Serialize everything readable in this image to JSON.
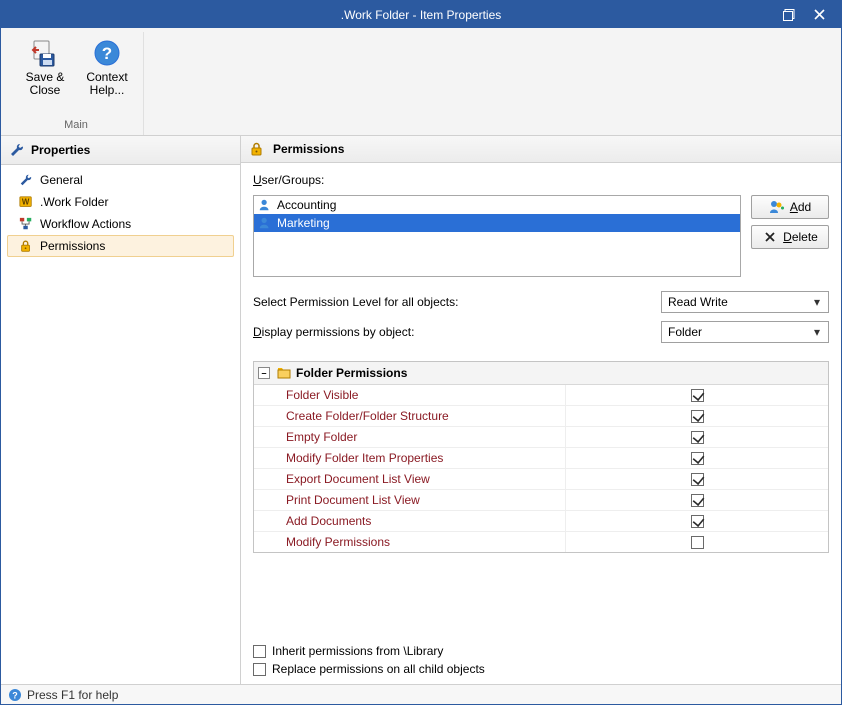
{
  "title": ".Work Folder - Item Properties",
  "ribbon": {
    "group_label": "Main",
    "save_close": "Save & Close",
    "context_help": "Context Help..."
  },
  "sidebar": {
    "header": "Properties",
    "items": [
      {
        "label": "General"
      },
      {
        "label": ".Work Folder"
      },
      {
        "label": "Workflow Actions"
      },
      {
        "label": "Permissions"
      }
    ],
    "selected_index": 3
  },
  "main": {
    "header": "Permissions",
    "user_groups_label": "User/Groups:",
    "user_groups": [
      {
        "name": "Accounting"
      },
      {
        "name": "Marketing"
      }
    ],
    "selected_group_index": 1,
    "add_btn": "Add",
    "delete_btn": "Delete",
    "select_level_label": "Select Permission Level for all objects:",
    "select_level_value": "Read Write",
    "display_by_label": "Display permissions by object:",
    "display_by_value": "Folder",
    "grid_title": "Folder Permissions",
    "permissions": [
      {
        "label": "Folder Visible",
        "checked": true
      },
      {
        "label": "Create Folder/Folder Structure",
        "checked": true
      },
      {
        "label": "Empty Folder",
        "checked": true
      },
      {
        "label": "Modify Folder Item Properties",
        "checked": true
      },
      {
        "label": "Export Document List View",
        "checked": true
      },
      {
        "label": "Print Document List View",
        "checked": true
      },
      {
        "label": "Add Documents",
        "checked": true
      },
      {
        "label": "Modify Permissions",
        "checked": false
      }
    ],
    "inherit_label": "Inherit permissions from  \\Library",
    "inherit_checked": false,
    "replace_label": "Replace permissions on all child objects",
    "replace_checked": false
  },
  "status": "Press F1 for help"
}
